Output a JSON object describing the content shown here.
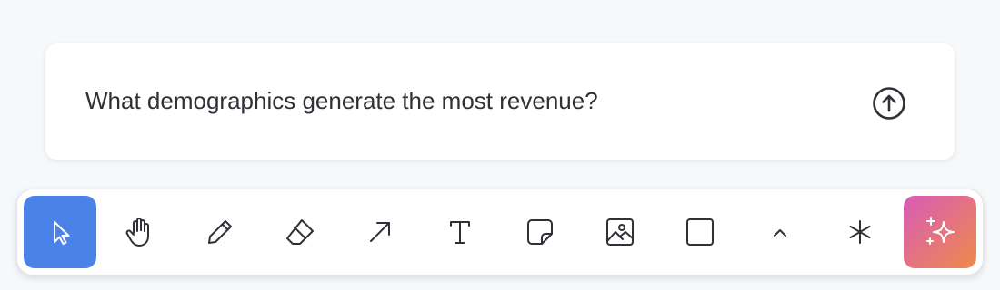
{
  "prompt": {
    "text": "What demographics generate the most revenue?",
    "submit_icon": "arrow-up-circle-icon"
  },
  "toolbar": {
    "active_tool": "select",
    "tools": [
      {
        "id": "select",
        "icon": "cursor-icon"
      },
      {
        "id": "hand",
        "icon": "hand-icon"
      },
      {
        "id": "pencil",
        "icon": "pencil-icon"
      },
      {
        "id": "eraser",
        "icon": "eraser-icon"
      },
      {
        "id": "arrow",
        "icon": "arrow-icon"
      },
      {
        "id": "text",
        "icon": "text-icon"
      },
      {
        "id": "sticky-note",
        "icon": "sticky-note-icon"
      },
      {
        "id": "image",
        "icon": "image-icon"
      },
      {
        "id": "rectangle",
        "icon": "square-icon"
      },
      {
        "id": "more",
        "icon": "chevron-up-icon"
      },
      {
        "id": "asterisk",
        "icon": "asterisk-icon"
      },
      {
        "id": "ai",
        "icon": "sparkles-icon"
      }
    ]
  },
  "colors": {
    "background": "#f7f8fa",
    "active_tool": "#4a82e8",
    "ai_gradient_start": "#d95bb7",
    "ai_gradient_end": "#ee8a4a",
    "icon": "#2f3136"
  }
}
